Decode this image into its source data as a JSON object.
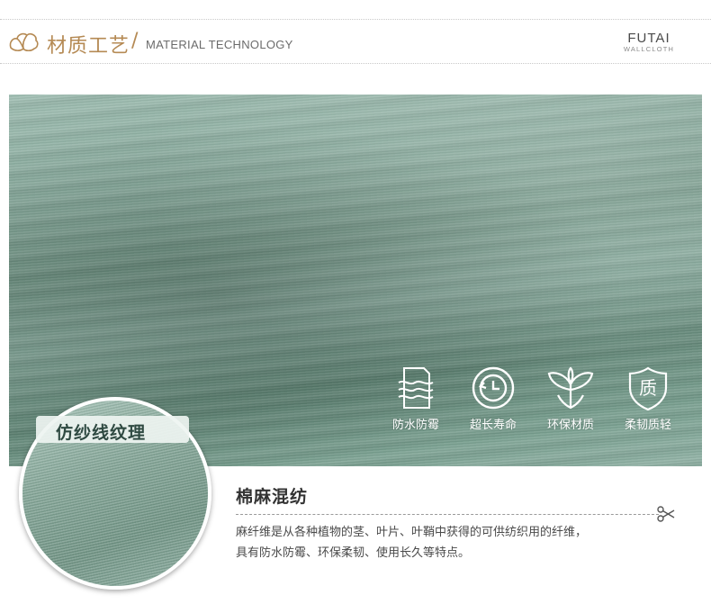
{
  "header": {
    "title_cn": "材质工艺",
    "slash": "/",
    "title_en": "MATERIAL TECHNOLOGY",
    "brand_name": "FUTAI",
    "brand_sub": "WALLCLOTH",
    "icon": "cotton-icon"
  },
  "features": [
    {
      "label": "防水防霉",
      "icon": "waves-icon"
    },
    {
      "label": "超长寿命",
      "icon": "clock-icon"
    },
    {
      "label": "环保材质",
      "icon": "leaf-icon"
    },
    {
      "label": "柔韧质轻",
      "icon": "quality-shield-icon"
    }
  ],
  "quality_glyph": "质",
  "zoom": {
    "label": "仿纱线纹理"
  },
  "description": {
    "title": "棉麻混纺",
    "lines": [
      "麻纤维是从各种植物的茎、叶片、叶鞘中获得的可供纺织用的纤维，",
      "具有防水防霉、环保柔韧、使用长久等特点。"
    ]
  },
  "colors": {
    "accent": "#b58a54",
    "fabric": "#7fa395",
    "text": "#4a4a4a"
  }
}
